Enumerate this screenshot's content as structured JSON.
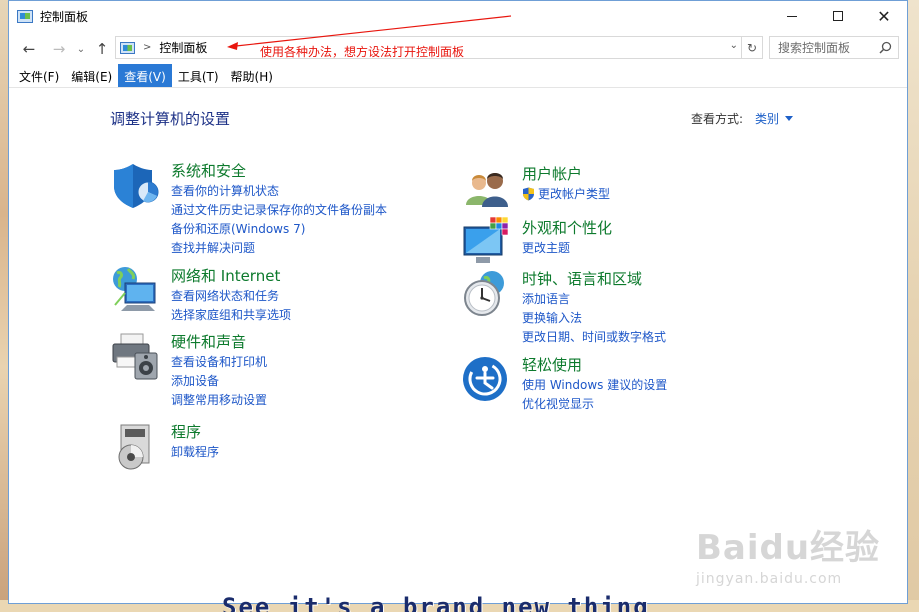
{
  "window": {
    "title": "控制面板",
    "accent": "#2a79d5"
  },
  "address": {
    "path": "控制面板",
    "search_placeholder": "搜索控制面板"
  },
  "annotation": {
    "text": "使用各种办法，想方设法打开控制面板",
    "color": "#e8160e"
  },
  "menu": [
    {
      "label": "文件(F)",
      "active": false
    },
    {
      "label": "编辑(E)",
      "active": false
    },
    {
      "label": "查看(V)",
      "active": true
    },
    {
      "label": "工具(T)",
      "active": false
    },
    {
      "label": "帮助(H)",
      "active": false
    }
  ],
  "content": {
    "title": "调整计算机的设置",
    "view_by_label": "查看方式:",
    "view_by_value": "类别"
  },
  "categories": {
    "system": {
      "icon": "security-shield-icon",
      "title": "系统和安全",
      "links": [
        "查看你的计算机状态",
        "通过文件历史记录保存你的文件备份副本",
        "备份和还原(Windows 7)",
        "查找并解决问题"
      ]
    },
    "network": {
      "icon": "network-globe-icon",
      "title": "网络和 Internet",
      "links": [
        "查看网络状态和任务",
        "选择家庭组和共享选项"
      ]
    },
    "hardware": {
      "icon": "printer-speaker-icon",
      "title": "硬件和声音",
      "links": [
        "查看设备和打印机",
        "添加设备",
        "调整常用移动设置"
      ]
    },
    "programs": {
      "icon": "programs-disc-icon",
      "title": "程序",
      "links": [
        "卸载程序"
      ]
    },
    "users": {
      "icon": "users-people-icon",
      "title": "用户帐户",
      "links": [
        "更改帐户类型"
      ]
    },
    "appearance": {
      "icon": "monitor-palette-icon",
      "title": "外观和个性化",
      "links": [
        "更改主题"
      ]
    },
    "clock": {
      "icon": "clock-globe-icon",
      "title": "时钟、语言和区域",
      "links": [
        "添加语言",
        "更换输入法",
        "更改日期、时间或数字格式"
      ]
    },
    "ease": {
      "icon": "ease-of-access-icon",
      "title": "轻松使用",
      "links": [
        "使用 Windows 建议的设置",
        "优化视觉显示"
      ]
    }
  },
  "watermark": {
    "brand": "Baidu经验",
    "url": "jingyan.baidu.com"
  },
  "subtitle": "See it's a brand new thing"
}
